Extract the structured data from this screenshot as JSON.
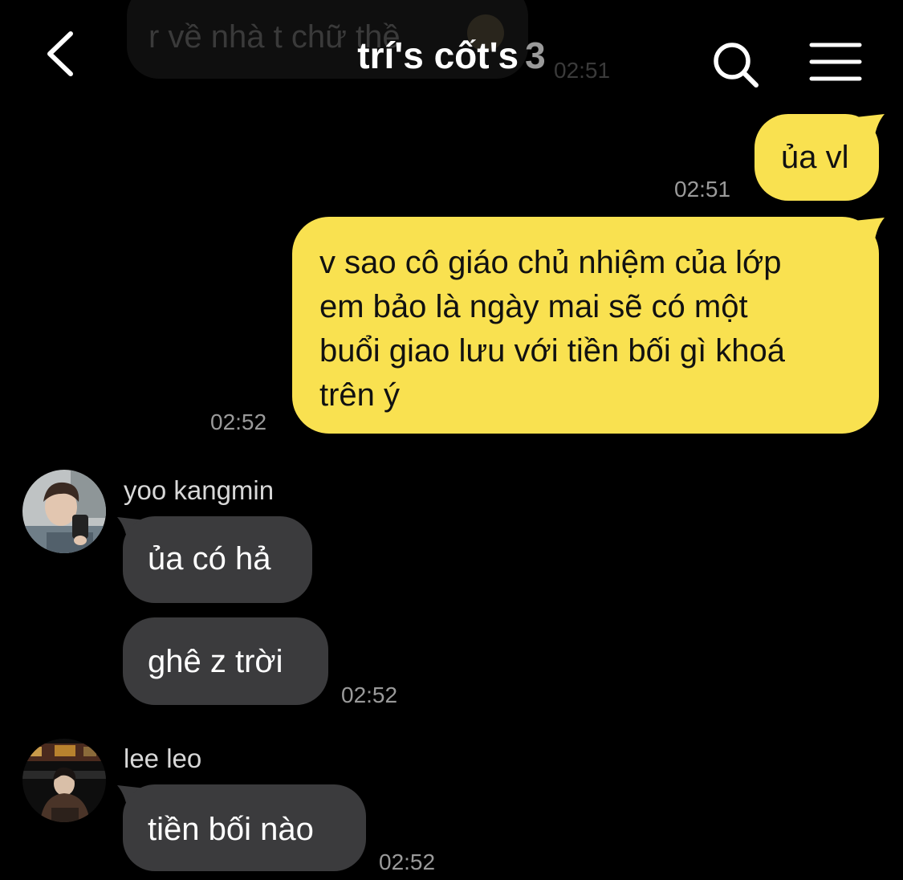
{
  "ghost_message": {
    "text": "r về nhà t chữ thề",
    "time": "02:51"
  },
  "header": {
    "title": "trí's cốt's",
    "member_count": "3",
    "back_icon": "chevron-left-icon",
    "search_icon": "search-icon",
    "menu_icon": "hamburger-menu-icon"
  },
  "messages": [
    {
      "from": "me",
      "lines": [
        "ủa vl"
      ],
      "time": "02:51"
    },
    {
      "from": "me",
      "lines": [
        "v sao cô giáo chủ nhiệm của lớp",
        "em bảo là ngày mai sẽ có một",
        "buổi giao lưu với tiền bối gì khoá",
        "trên ý"
      ],
      "time": "02:52"
    },
    {
      "from": "yoo kangmin",
      "text": "ủa có hả"
    },
    {
      "from": "yoo kangmin",
      "text": "ghê z trời",
      "time": "02:52"
    },
    {
      "from": "lee leo",
      "text": "tiền bối nào",
      "time": "02:52"
    }
  ],
  "senders": {
    "yoo": "yoo kangmin",
    "lee": "lee leo"
  },
  "colors": {
    "background": "#000000",
    "my_bubble": "#f9e150",
    "other_bubble": "#3b3b3d",
    "timestamp": "#9a9a9a"
  }
}
